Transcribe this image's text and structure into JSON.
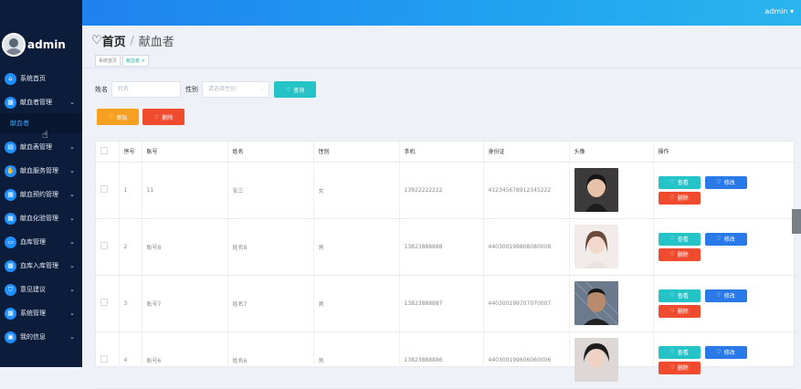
{
  "topbar": {
    "user": "admin ▾"
  },
  "sidebar": {
    "user_name": "admin",
    "items": [
      {
        "label": "系统首页",
        "icon": "home-icon",
        "chev": false
      },
      {
        "label": "献血者管理",
        "icon": "grid-icon",
        "chev": true
      },
      {
        "label": "献血表管理",
        "icon": "clipboard-icon",
        "chev": true
      },
      {
        "label": "献血服务管理",
        "icon": "hand-icon",
        "chev": true
      },
      {
        "label": "献血预约管理",
        "icon": "calendar-icon",
        "chev": true
      },
      {
        "label": "献血化验管理",
        "icon": "grid-icon",
        "chev": true
      },
      {
        "label": "血库管理",
        "icon": "monitor-icon",
        "chev": true
      },
      {
        "label": "血库入库管理",
        "icon": "grid-icon",
        "chev": true
      },
      {
        "label": "意见建议",
        "icon": "shield-icon",
        "chev": true
      },
      {
        "label": "系统管理",
        "icon": "grid-icon",
        "chev": true
      },
      {
        "label": "我的信息",
        "icon": "card-icon",
        "chev": true
      }
    ],
    "submenu": {
      "label": "献血者"
    }
  },
  "header": {
    "title": "首页",
    "separator": "/",
    "subtitle": "献血者"
  },
  "tabs": [
    {
      "label": "系统首页",
      "active": false
    },
    {
      "label": "献血者 ×",
      "active": true
    }
  ],
  "search": {
    "name_label": "姓名",
    "name_placeholder": "姓名",
    "gender_label": "性别",
    "gender_placeholder": "请选择性别",
    "query_button": "查询"
  },
  "toolbar": {
    "add_button": "添加",
    "delete_button": "删除"
  },
  "table": {
    "columns": [
      "",
      "序号",
      "账号",
      "姓名",
      "性别",
      "手机",
      "身份证",
      "头像",
      "操作"
    ],
    "rows": [
      {
        "index": "1",
        "account": "11",
        "name": "张三",
        "gender": "女",
        "phone": "13922222222",
        "id_card": "412345678912345222"
      },
      {
        "index": "2",
        "account": "账号8",
        "name": "姓名8",
        "gender": "男",
        "phone": "13823888888",
        "id_card": "440300199808080008"
      },
      {
        "index": "3",
        "account": "账号7",
        "name": "姓名7",
        "gender": "男",
        "phone": "13823888887",
        "id_card": "440300199707070007"
      },
      {
        "index": "4",
        "account": "账号6",
        "name": "姓名6",
        "gender": "男",
        "phone": "13823888886",
        "id_card": "440300199606060006"
      }
    ],
    "actions": {
      "view": "查看",
      "edit": "修改",
      "delete": "删除"
    }
  },
  "colors": {
    "accent": "#1f8fff",
    "sidebar_bg": "#0b1d3a",
    "topbar": "#1e7bf0",
    "query": "#23c3c7",
    "add": "#f7a021",
    "delete": "#f04b2e",
    "edit": "#2a79e8"
  }
}
